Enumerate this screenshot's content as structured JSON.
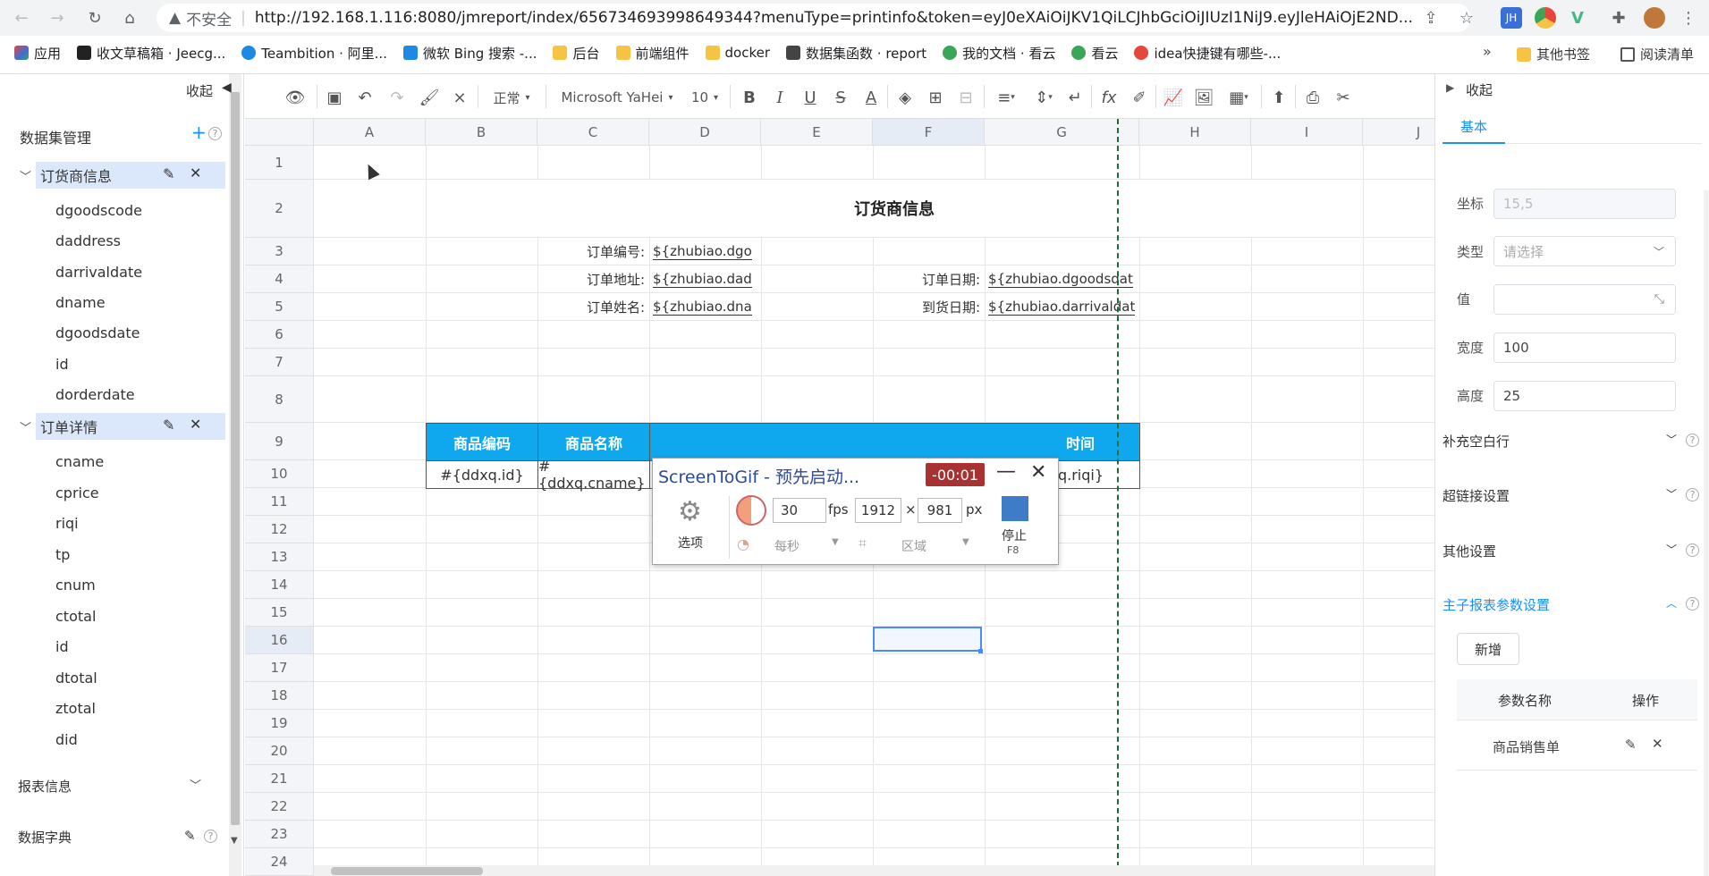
{
  "browser": {
    "insecure_label": "不安全",
    "url": "http://192.168.1.116:8080/jmreport/index/656734693998649344?menuType=printinfo&token=eyJ0eXAiOiJKV1QiLCJhbGciOiJIUzI1NiJ9.eyJleHAiOjE2ND...",
    "bookmarks": [
      {
        "label": "应用",
        "color": "#e8453c"
      },
      {
        "label": "收文草稿箱 · Jeecg...",
        "color": "#222222"
      },
      {
        "label": "Teambition · 阿里...",
        "color": "#1e88e5"
      },
      {
        "label": "微软 Bing 搜索 -...",
        "color": "#1e88e5"
      },
      {
        "label": "后台",
        "color": "#f6c344"
      },
      {
        "label": "前端组件",
        "color": "#f6c344"
      },
      {
        "label": "docker",
        "color": "#f6c344"
      },
      {
        "label": "数据集函数 · report",
        "color": "#444444"
      },
      {
        "label": "我的文档 · 看云",
        "color": "#3aa757"
      },
      {
        "label": "看云",
        "color": "#3aa757"
      },
      {
        "label": "idea快捷键有哪些-...",
        "color": "#e8453c"
      }
    ],
    "more_label": "»",
    "other_bookmarks": "其他书签",
    "reading_list": "阅读清单",
    "ext_jh": "JH"
  },
  "left_panel": {
    "collapse_label": "收起",
    "dataset_title": "数据集管理",
    "groups": [
      {
        "name": "订货商信息",
        "fields": [
          "dgoodscode",
          "daddress",
          "darrivaldate",
          "dname",
          "dgoodsdate",
          "id",
          "dorderdate"
        ]
      },
      {
        "name": "订单详情",
        "fields": [
          "cname",
          "cprice",
          "riqi",
          "tp",
          "cnum",
          "ctotal",
          "id",
          "dtotal",
          "ztotal",
          "did"
        ]
      }
    ],
    "report_info": "报表信息",
    "data_dict": "数据字典"
  },
  "toolbar": {
    "format": "正常",
    "font": "Microsoft YaHei",
    "size": "10"
  },
  "sheet": {
    "columns": [
      "A",
      "B",
      "C",
      "D",
      "E",
      "F",
      "G",
      "H",
      "I",
      "J"
    ],
    "rows": [
      "1",
      "2",
      "3",
      "4",
      "5",
      "6",
      "7",
      "8",
      "9",
      "10",
      "11",
      "12",
      "13",
      "14",
      "15",
      "16",
      "17",
      "18",
      "19",
      "20",
      "21",
      "22",
      "23",
      "24"
    ],
    "title": "订货商信息",
    "labels": {
      "order_no": "订单编号:",
      "order_addr": "订单地址:",
      "order_name": "订单姓名:",
      "order_date": "订单日期:",
      "arrive_date": "到货日期:"
    },
    "fields": {
      "dgoodscode": "${zhubiao.dgo",
      "daddress": "${zhubiao.dad",
      "dname": "${zhubiao.dna",
      "dgoodsdate": "${zhubiao.dgoodsdat",
      "darrivaldate": "${zhubiao.darrivaldat"
    },
    "table_headers": [
      "商品编码",
      "商品名称",
      "时间"
    ],
    "table_cells": [
      "#{ddxq.id}",
      "#{ddxq.cname}",
      "xq.riqi}"
    ]
  },
  "right_panel": {
    "collapse_label": "收起",
    "tab": "基本",
    "coord_label": "坐标",
    "coord_value": "15,5",
    "type_label": "类型",
    "type_placeholder": "请选择",
    "value_label": "值",
    "width_label": "宽度",
    "width_value": "100",
    "height_label": "高度",
    "height_value": "25",
    "sections": [
      "补充空白行",
      "超链接设置",
      "其他设置"
    ],
    "param_section": "主子报表参数设置",
    "add_button": "新增",
    "table_headers": [
      "参数名称",
      "操作"
    ],
    "param_rows": [
      "商品销售单"
    ]
  },
  "screentogif": {
    "title": "ScreenToGif - 预先启动...",
    "timer": "-00:01",
    "options_label": "选项",
    "fps_value": "30",
    "fps_unit": "fps",
    "width_value": "1912",
    "times": "×",
    "height_value": "981",
    "px_unit": "px",
    "per_second": "每秒",
    "region": "区域",
    "stop_label": "停止",
    "stop_key": "F8"
  }
}
